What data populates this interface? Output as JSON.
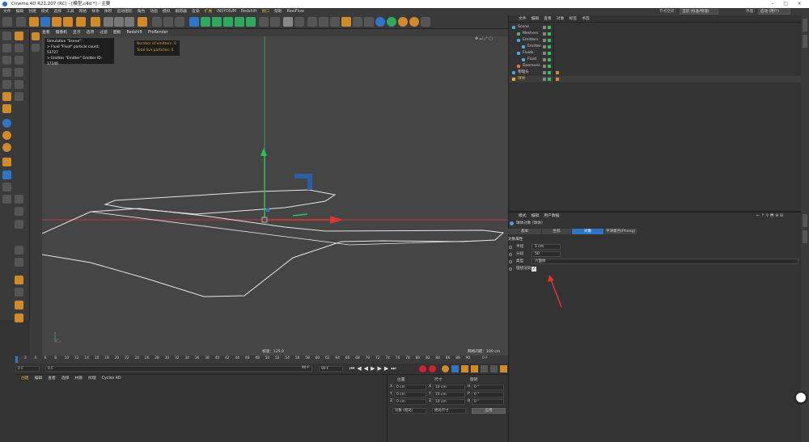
{
  "window": {
    "title": "Cinema 4D R21.207 (RC) - [模型.c4d *] - 主要",
    "controls": [
      "–",
      "□",
      "✕"
    ]
  },
  "menubar": {
    "items": [
      {
        "label": "文件",
        "hl": false
      },
      {
        "label": "编辑",
        "hl": false
      },
      {
        "label": "创建",
        "hl": false
      },
      {
        "label": "模式",
        "hl": false
      },
      {
        "label": "选择",
        "hl": false
      },
      {
        "label": "工具",
        "hl": false
      },
      {
        "label": "网格",
        "hl": false
      },
      {
        "label": "样条",
        "hl": false
      },
      {
        "label": "体积",
        "hl": false
      },
      {
        "label": "运动图形",
        "hl": false
      },
      {
        "label": "角色",
        "hl": false
      },
      {
        "label": "动画",
        "hl": false
      },
      {
        "label": "模拟",
        "hl": false
      },
      {
        "label": "跟踪器",
        "hl": false
      },
      {
        "label": "渲染",
        "hl": false
      },
      {
        "label": "扩展",
        "hl": true
      },
      {
        "label": "INSYDIUM",
        "hl": false
      },
      {
        "label": "Redshift",
        "hl": false
      },
      {
        "label": "窗口",
        "hl": true
      },
      {
        "label": "帮助",
        "hl": false
      },
      {
        "label": "RealFlow",
        "hl": false
      }
    ],
    "node_space_label": "节点空间：",
    "node_space_value": "当前 (标准/物理)",
    "layout_label": "界面：",
    "layout_value": "启动 (用户)"
  },
  "viewport": {
    "menu": [
      "查看",
      "摄像机",
      "显示",
      "选项",
      "过滤",
      "面板",
      "Redshift",
      "ProRender"
    ],
    "camera_label": "透视视图",
    "overlay_lines": [
      "Simulation \"Scene\":",
      "> Fluid \"Fluid\" particle count: 53727",
      "> Emitter \"Emitter\" Emitter ID: 17246"
    ],
    "emitter_lines": [
      "Number of emitters: 0",
      "Total live particles: 0"
    ],
    "speed_text": "帧速：125.0",
    "grid_text": "网格间距：100 cm"
  },
  "timeline": {
    "ticks": [
      "2",
      "4",
      "6",
      "8",
      "10",
      "12",
      "14",
      "16",
      "18",
      "20",
      "22",
      "24",
      "26",
      "28",
      "30",
      "32",
      "34",
      "36",
      "38",
      "40",
      "42",
      "44",
      "46",
      "48",
      "50",
      "52",
      "54",
      "56",
      "58",
      "60",
      "62",
      "64",
      "66",
      "68",
      "70",
      "72",
      "74",
      "76",
      "78",
      "80",
      "82",
      "84",
      "86",
      "88",
      "90"
    ],
    "end_label": "0 F",
    "start_frame": "0 F",
    "current_frame": "0 F",
    "max_frame_a": "90 F",
    "max_frame_b": "90 F"
  },
  "material_manager": {
    "menu": [
      "创建",
      "编辑",
      "查看",
      "选择",
      "材质",
      "纹理",
      "Cycles 4D"
    ]
  },
  "coordinates": {
    "headers": [
      "位置",
      "尺寸",
      "旋转"
    ],
    "rows": [
      {
        "axis": "X",
        "pos": "0 cm",
        "size_axis": "X",
        "size": "10 cm",
        "rot_axis": "H",
        "rot": "0 °"
      },
      {
        "axis": "Y",
        "pos": "0 cm",
        "size_axis": "Y",
        "size": "10 cm",
        "rot_axis": "P",
        "rot": "0 °"
      },
      {
        "axis": "Z",
        "pos": "0 cm",
        "size_axis": "Z",
        "size": "10 cm",
        "rot_axis": "B",
        "rot": "0 °"
      }
    ],
    "mode": "对象 (相对)",
    "size_mode": "绝对尺寸",
    "apply": "应用"
  },
  "object_manager": {
    "menu": [
      "文件",
      "编辑",
      "查看",
      "对象",
      "标签",
      "书签"
    ],
    "objects": [
      {
        "name": "Scene",
        "indent": 0,
        "color": "#4fa3e0"
      },
      {
        "name": "Meshers",
        "indent": 1,
        "color": "#47b86a"
      },
      {
        "name": "Emitters",
        "indent": 1,
        "color": "#4fa3e0"
      },
      {
        "name": "Emitter",
        "indent": 2,
        "color": "#4fa3e0"
      },
      {
        "name": "Fluids",
        "indent": 1,
        "color": "#4fa3e0"
      },
      {
        "name": "Fluid",
        "indent": 2,
        "color": "#4fa3e0"
      },
      {
        "name": "Daemons",
        "indent": 1,
        "color": "#e07a3a"
      },
      {
        "name": "物理头",
        "indent": 0,
        "color": "#4fa3e0"
      },
      {
        "name": "球体",
        "indent": 0,
        "color": "#e6b23a"
      }
    ]
  },
  "attribute_manager": {
    "menu": [
      "模式",
      "编辑",
      "用户数据"
    ],
    "object_title": "球体对象 [球体]",
    "tabs": [
      "基本",
      "坐标",
      "对象",
      "平滑着色(Phong)"
    ],
    "active_tab": 2,
    "section": "对象属性",
    "fields": [
      {
        "label": "半径",
        "value": "5 cm"
      },
      {
        "label": "分段",
        "value": "50"
      },
      {
        "label": "类型",
        "value": "六面体"
      },
      {
        "label": "理想渲染",
        "value": "✓"
      }
    ]
  },
  "colors": {
    "accent": "#e6b23a",
    "x_axis": "#e0342f",
    "y_axis": "#2fc25b",
    "z_axis": "#3d7fe0",
    "annotation_arrow": "#e0342f"
  }
}
